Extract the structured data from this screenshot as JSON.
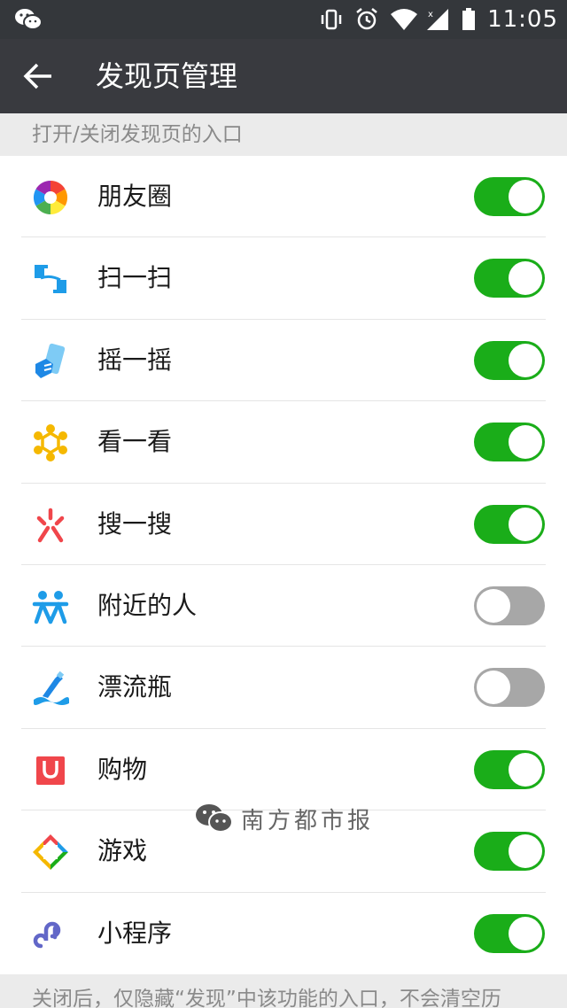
{
  "status_bar": {
    "time": "11:05",
    "left_icon": "wechat-icon",
    "right_icons": [
      "vibrate-icon",
      "alarm-icon",
      "wifi-icon",
      "signal-icon",
      "battery-icon"
    ]
  },
  "header": {
    "title": "发现页管理",
    "back_icon": "arrow-left-icon"
  },
  "section_header": "打开/关闭发现页的入口",
  "items": [
    {
      "label": "朋友圈",
      "icon": "moments-icon",
      "enabled": true
    },
    {
      "label": "扫一扫",
      "icon": "scan-icon",
      "enabled": true
    },
    {
      "label": "摇一摇",
      "icon": "shake-icon",
      "enabled": true
    },
    {
      "label": "看一看",
      "icon": "top-stories-icon",
      "enabled": true
    },
    {
      "label": "搜一搜",
      "icon": "search-icon",
      "enabled": true
    },
    {
      "label": "附近的人",
      "icon": "people-nearby-icon",
      "enabled": false
    },
    {
      "label": "漂流瓶",
      "icon": "drift-bottle-icon",
      "enabled": false
    },
    {
      "label": "购物",
      "icon": "shopping-icon",
      "enabled": true
    },
    {
      "label": "游戏",
      "icon": "games-icon",
      "enabled": true
    },
    {
      "label": "小程序",
      "icon": "mini-programs-icon",
      "enabled": true
    }
  ],
  "footer_note": "关闭后，仅隐藏“发现”中该功能的入口，不会清空历",
  "watermark": {
    "text": "南方都市报",
    "icon": "wechat-logo-icon"
  },
  "colors": {
    "toggle_on": "#1aad19",
    "toggle_off": "#a7a7a7",
    "app_bar": "#393a3f",
    "status_bar": "#34373b"
  }
}
